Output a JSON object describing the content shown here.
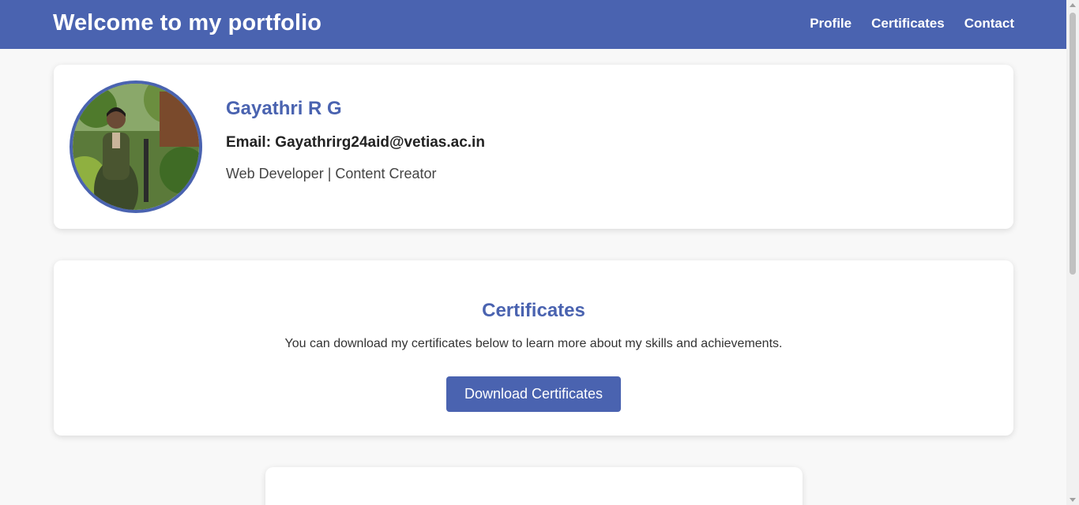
{
  "header": {
    "title": "Welcome to my portfolio",
    "nav": [
      {
        "label": "Profile"
      },
      {
        "label": "Certificates"
      },
      {
        "label": "Contact"
      }
    ]
  },
  "profile": {
    "name": "Gayathri R G",
    "email": "Email: Gayathrirg24aid@vetias.ac.in",
    "role": "Web Developer | Content Creator",
    "avatar_icon": "profile-photo"
  },
  "certificates": {
    "heading": "Certificates",
    "description": "You can download my certificates below to learn more about my skills and achievements.",
    "button_label": "Download Certificates"
  },
  "colors": {
    "accent": "#4a63b0",
    "background": "#f8f8f8",
    "card": "#ffffff"
  }
}
